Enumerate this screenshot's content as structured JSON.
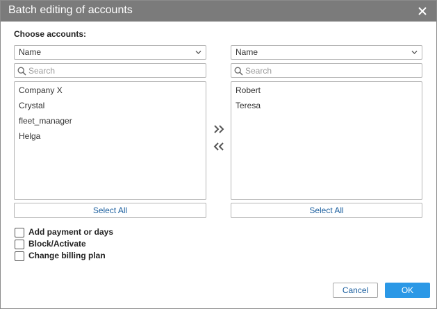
{
  "dialog": {
    "title": "Batch editing of accounts",
    "close_icon": "close-icon"
  },
  "choose_label": "Choose accounts:",
  "left_panel": {
    "sort_select": {
      "value": "Name",
      "icon": "chevron-down-icon"
    },
    "search": {
      "placeholder": "Search",
      "icon": "search-icon"
    },
    "items": [
      "Company X",
      "Crystal",
      "fleet_manager",
      "Helga"
    ],
    "select_all_label": "Select All"
  },
  "right_panel": {
    "sort_select": {
      "value": "Name",
      "icon": "chevron-down-icon"
    },
    "search": {
      "placeholder": "Search",
      "icon": "search-icon"
    },
    "items": [
      "Robert",
      "Teresa"
    ],
    "select_all_label": "Select All"
  },
  "transfer": {
    "add_icon": "double-chevron-right-icon",
    "remove_icon": "double-chevron-left-icon"
  },
  "options": [
    {
      "label": "Add payment or days",
      "checked": false
    },
    {
      "label": "Block/Activate",
      "checked": false
    },
    {
      "label": "Change billing plan",
      "checked": false
    }
  ],
  "footer": {
    "cancel_label": "Cancel",
    "ok_label": "OK"
  },
  "colors": {
    "titlebar": "#7b7b7b",
    "accent": "#2b98e6",
    "link_text": "#1a5e9e"
  }
}
